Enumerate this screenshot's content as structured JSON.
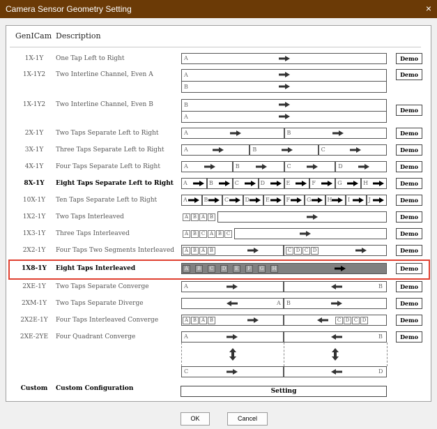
{
  "window": {
    "title": "Camera Sensor Geometry Setting",
    "close_glyph": "×"
  },
  "header": {
    "code": "GenICam",
    "description": "Description"
  },
  "rows": [
    {
      "code": "1X-1Y",
      "desc": "One Tap Left to Right",
      "demo": "Demo"
    },
    {
      "code": "1X-1Y2",
      "desc": "Two Interline Channel, Even A",
      "demo": "Demo"
    },
    {
      "code": "1X-1Y2",
      "desc": "Two Interline Channel, Even B",
      "demo": "Demo"
    },
    {
      "code": "2X-1Y",
      "desc": "Two Taps Separate Left to Right",
      "demo": "Demo"
    },
    {
      "code": "3X-1Y",
      "desc": "Three Taps Separate Left to Right",
      "demo": "Demo"
    },
    {
      "code": "4X-1Y",
      "desc": "Four Taps Separate Left to Right",
      "demo": "Demo"
    },
    {
      "code": "8X-1Y",
      "desc": "Eight Taps Separate Left to Right",
      "demo": "Demo"
    },
    {
      "code": "10X-1Y",
      "desc": "Ten Taps Separate Left to Right",
      "demo": "Demo"
    },
    {
      "code": "1X2-1Y",
      "desc": "Two Taps Interleaved",
      "demo": "Demo"
    },
    {
      "code": "1X3-1Y",
      "desc": "Three Taps Interleaved",
      "demo": "Demo"
    },
    {
      "code": "2X2-1Y",
      "desc": "Four Taps Two Segments Interleaved",
      "demo": "Demo"
    },
    {
      "code": "1X8-1Y",
      "desc": "Eight Taps Interleaved",
      "demo": "Demo",
      "selected": true
    },
    {
      "code": "2XE-1Y",
      "desc": "Two Taps Separate Converge",
      "demo": "Demo"
    },
    {
      "code": "2XM-1Y",
      "desc": "Two Taps Separate Diverge",
      "demo": "Demo"
    },
    {
      "code": "2X2E-1Y",
      "desc": "Four Taps Interleaved Converge",
      "demo": "Demo"
    },
    {
      "code": "2XE-2YE",
      "desc": "Four Quadrant Converge",
      "demo": "Demo"
    }
  ],
  "letters": {
    "A": "A",
    "B": "B",
    "C": "C",
    "D": "D",
    "E": "E",
    "F": "F",
    "G": "G",
    "H": "H",
    "I": "I",
    "J": "J"
  },
  "custom": {
    "code": "Custom",
    "desc": "Custom Configuration",
    "setting": "Setting"
  },
  "buttons": {
    "ok": "OK",
    "cancel": "Cancel"
  },
  "colors": {
    "titlebar": "#6b3a06",
    "highlight": "#e04030",
    "selected_fill": "#808080"
  }
}
